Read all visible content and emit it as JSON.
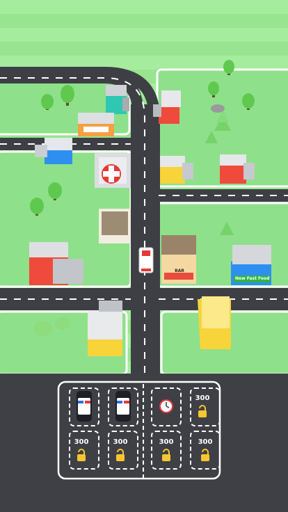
{
  "game": {
    "colors": {
      "grass_light": "#a6ec9f",
      "grass_stripe": "#98e491",
      "block_grass": "#8fe08a",
      "road": "#3e3f45",
      "road_edge": "#ffffff",
      "lane_mark": "#ffffff",
      "parking_lot": "#3f4045",
      "slot_dash": "#ffffff",
      "lock_yellow": "#f7c62f"
    },
    "parking": {
      "slots": [
        {
          "id": "slot-1",
          "state": "occupied",
          "content": "police-car"
        },
        {
          "id": "slot-2",
          "state": "occupied",
          "content": "police-car"
        },
        {
          "id": "slot-3",
          "state": "timer",
          "content": "clock-icon"
        },
        {
          "id": "slot-4",
          "state": "locked",
          "price": "300"
        },
        {
          "id": "slot-5",
          "state": "locked",
          "price": "300"
        },
        {
          "id": "slot-6",
          "state": "locked",
          "price": "300"
        },
        {
          "id": "slot-7",
          "state": "locked",
          "price": "300"
        },
        {
          "id": "slot-8",
          "state": "locked",
          "price": "300"
        }
      ]
    },
    "signs": {
      "shop_bar": "BAR",
      "fast_food": "New Fast Food"
    },
    "vehicles": {
      "on_road": "ambulance"
    }
  }
}
